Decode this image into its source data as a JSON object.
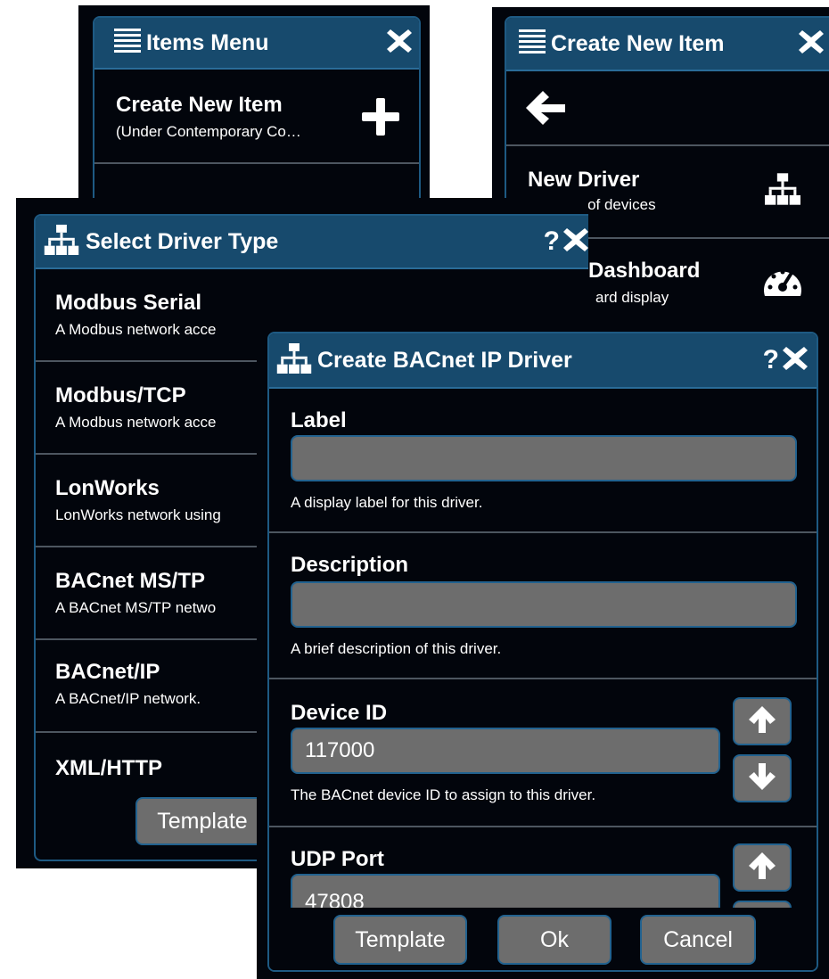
{
  "items_menu": {
    "title": "Items Menu",
    "icons": {
      "title": "list-icon",
      "close": "close-icon",
      "add": "plus-icon"
    },
    "items": [
      {
        "title": "Create New Item",
        "subtitle": "(Under Contemporary Co…"
      }
    ]
  },
  "create_new_item": {
    "title": "Create New Item",
    "icons": {
      "title": "list-icon",
      "close": "close-icon",
      "back": "back-arrow-icon"
    },
    "items": [
      {
        "title": "New Driver",
        "subtitle": "Network of devices",
        "icon": "network-icon"
      },
      {
        "title": "Dashboard",
        "subtitle": "ard display",
        "icon": "gauge-icon"
      }
    ]
  },
  "select_driver": {
    "title": "Select Driver Type",
    "help": "?",
    "icons": {
      "title": "network-icon",
      "close": "close-icon"
    },
    "items": [
      {
        "title": "Modbus Serial",
        "subtitle": "A Modbus network acce"
      },
      {
        "title": "Modbus/TCP",
        "subtitle": "A Modbus network acce"
      },
      {
        "title": "LonWorks",
        "subtitle": "LonWorks network using"
      },
      {
        "title": "BACnet MS/TP",
        "subtitle": "A BACnet MS/TP netwo"
      },
      {
        "title": "BACnet/IP",
        "subtitle": "A BACnet/IP network."
      },
      {
        "title": "XML/HTTP",
        "subtitle": ""
      }
    ],
    "template_button": "Template"
  },
  "create_bacnet": {
    "title": "Create BACnet IP Driver",
    "help": "?",
    "icons": {
      "title": "network-icon",
      "close": "close-icon",
      "up": "arrow-up-icon",
      "down": "arrow-down-icon"
    },
    "fields": {
      "label": {
        "label": "Label",
        "value": "",
        "help": "A display label for this driver."
      },
      "description": {
        "label": "Description",
        "value": "",
        "help": "A brief description of this driver."
      },
      "device_id": {
        "label": "Device ID",
        "value": "117000",
        "help": "The BACnet device ID to assign to this driver."
      },
      "udp_port": {
        "label": "UDP Port",
        "value": "47808"
      }
    },
    "buttons": {
      "template": "Template",
      "ok": "Ok",
      "cancel": "Cancel"
    }
  },
  "colors": {
    "accent": "#174a6d",
    "border": "#1e5a83",
    "background": "#02050c",
    "input": "#6d6d6d"
  }
}
